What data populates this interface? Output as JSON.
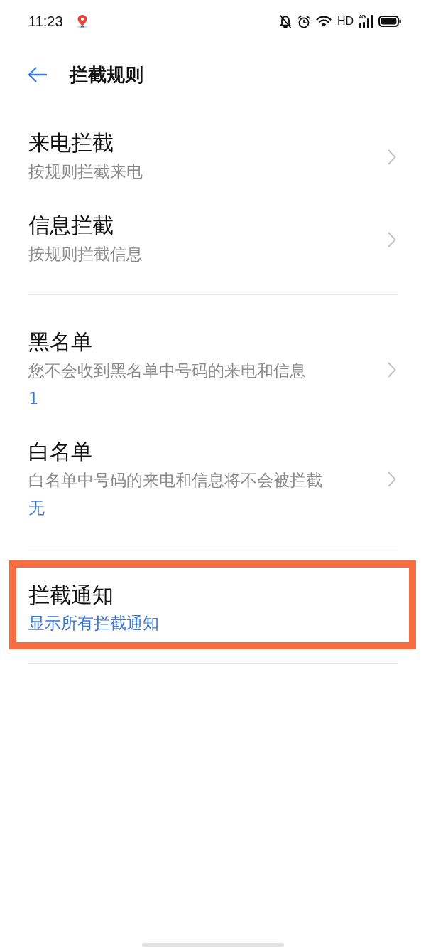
{
  "status_bar": {
    "time": "11:23",
    "hd_label": "HD",
    "network_label": "4G"
  },
  "header": {
    "title": "拦截规则"
  },
  "sections": [
    {
      "items": [
        {
          "title": "来电拦截",
          "subtitle": "按规则拦截来电",
          "chevron": true,
          "highlighted": false
        },
        {
          "title": "信息拦截",
          "subtitle": "按规则拦截信息",
          "chevron": true,
          "highlighted": false
        }
      ]
    },
    {
      "items": [
        {
          "title": "黑名单",
          "subtitle": "您不会收到黑名单中号码的来电和信息",
          "summary": "1",
          "chevron": true,
          "highlighted": false
        },
        {
          "title": "白名单",
          "subtitle": "白名单中号码的来电和信息将不会被拦截",
          "summary": "无",
          "chevron": true,
          "highlighted": false
        }
      ]
    },
    {
      "items": [
        {
          "title": "拦截通知",
          "summary": "显示所有拦截通知",
          "chevron": false,
          "highlighted": true
        }
      ]
    }
  ]
}
